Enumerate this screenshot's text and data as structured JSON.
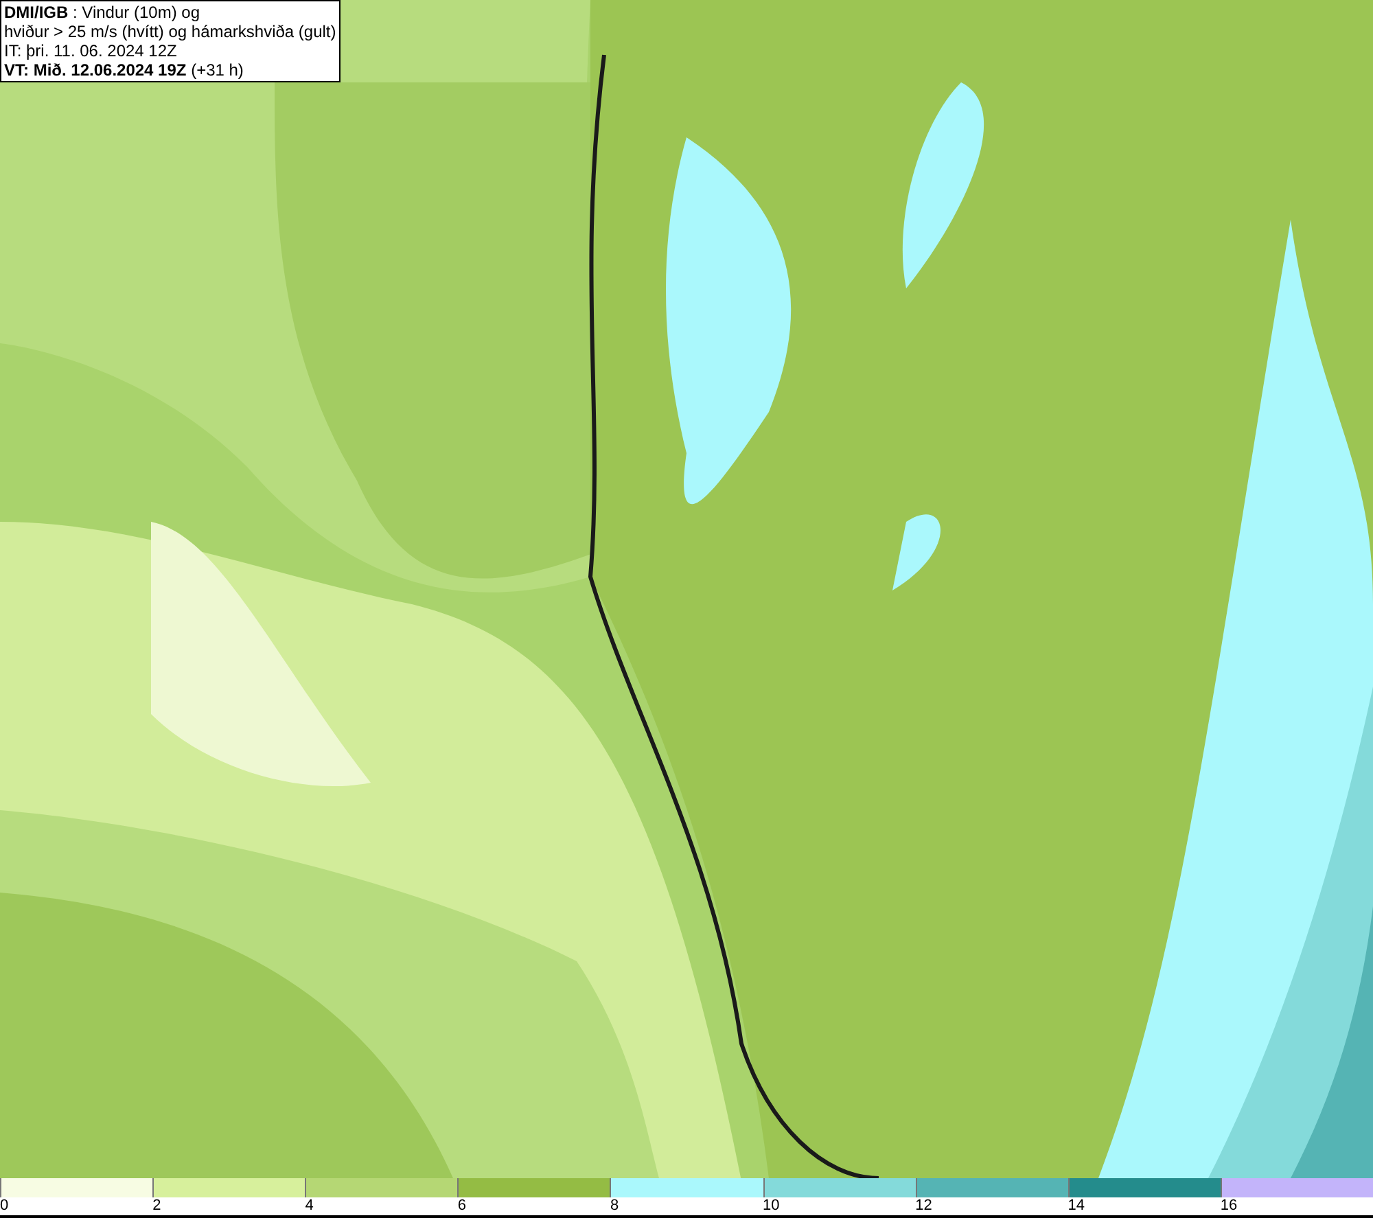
{
  "header": {
    "lines": [
      "**DMI/IGB** : Vindur (10m) og",
      "hviður > 25 m/s (hvítt) og hámarkshviða (gult)",
      "IT: þri. 11. 06. 2024 12Z",
      "**VT: Mið. 12.06.2024 19Z** (+31 h)"
    ]
  },
  "legend": {
    "bins": [
      {
        "label": "0",
        "color": "#f7fce3"
      },
      {
        "label": "2",
        "color": "#d7f09c"
      },
      {
        "label": "4",
        "color": "#b5d774"
      },
      {
        "label": "6",
        "color": "#94bc44"
      },
      {
        "label": "8",
        "color": "#aaf8fc"
      },
      {
        "label": "10",
        "color": "#84dada"
      },
      {
        "label": "12",
        "color": "#55b4b4"
      },
      {
        "label": "14",
        "color": "#248c8c"
      },
      {
        "label": "16",
        "color": "#c3b4fa"
      }
    ]
  }
}
